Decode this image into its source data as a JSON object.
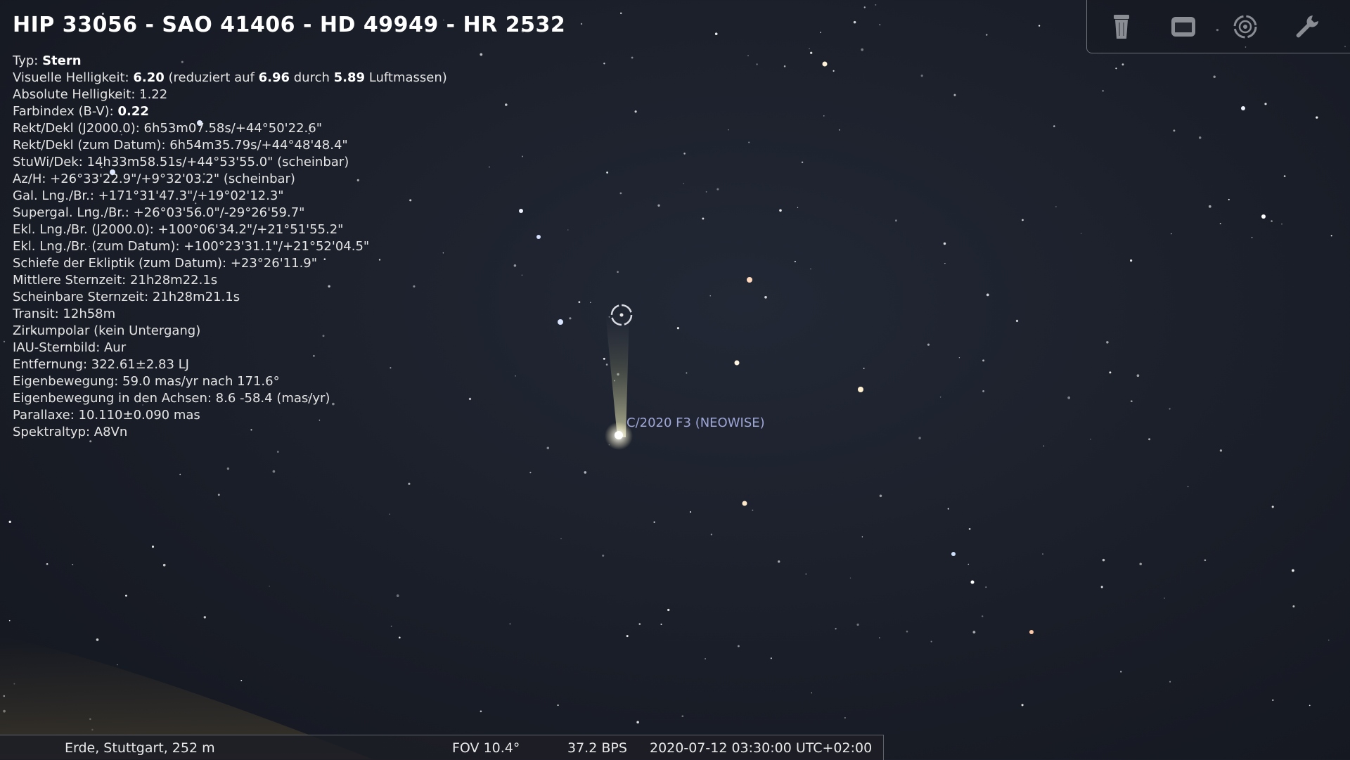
{
  "info": {
    "title": "HIP 33056 - SAO 41406 - HD 49949 - HR 2532",
    "lines": [
      {
        "label": "Typ: ",
        "value": "Stern"
      },
      {
        "label": "Visuelle Helligkeit: ",
        "value": "6.20",
        "extra": " (reduziert auf ",
        "value2": "6.96",
        "extra2": " durch ",
        "value3": "5.89",
        "extra3": " Luftmassen)"
      },
      {
        "label": "Absolute Helligkeit: 1.22"
      },
      {
        "label": "Farbindex (B-V): ",
        "value": "0.22"
      },
      {
        "label": "Rekt/Dekl (J2000.0): 6h53m07.58s/+44°50'22.6\""
      },
      {
        "label": "Rekt/Dekl (zum Datum): 6h54m35.79s/+44°48'48.4\""
      },
      {
        "label": "StuWi/Dek: 14h33m58.51s/+44°53'55.0\" (scheinbar)"
      },
      {
        "label": "Az/H: +26°33'22.9\"/+9°32'03.2\" (scheinbar)"
      },
      {
        "label": "Gal. Lng./Br.: +171°31'47.3\"/+19°02'12.3\""
      },
      {
        "label": "Supergal. Lng./Br.: +26°03'56.0\"/-29°26'59.7\""
      },
      {
        "label": "Ekl. Lng./Br. (J2000.0): +100°06'34.2\"/+21°51'55.2\""
      },
      {
        "label": "Ekl. Lng./Br. (zum Datum): +100°23'31.1\"/+21°52'04.5\""
      },
      {
        "label": "Schiefe der Ekliptik (zum Datum): +23°26'11.9\""
      },
      {
        "label": "Mittlere Sternzeit: 21h28m22.1s"
      },
      {
        "label": "Scheinbare Sternzeit: 21h28m21.1s"
      },
      {
        "label": "Transit: 12h58m"
      },
      {
        "label": "Zirkumpolar (kein Untergang)"
      },
      {
        "label": "IAU-Sternbild: Aur"
      },
      {
        "label": "Entfernung: 322.61±2.83 LJ"
      },
      {
        "label": "Eigenbewegung: 59.0 mas/yr nach 171.6°"
      },
      {
        "label": "Eigenbewegung in den Achsen: 8.6 -58.4 (mas/yr)"
      },
      {
        "label": "Parallaxe: 10.110±0.090 mas"
      },
      {
        "label": "Spektraltyp: A8Vn"
      }
    ]
  },
  "comet": {
    "label": "C/2020 F3 (NEOWISE)"
  },
  "toolbar": {
    "icons": [
      "trash-icon",
      "window-icon",
      "target-icon",
      "wrench-icon"
    ]
  },
  "status": {
    "location": "Erde, Stuttgart, 252 m",
    "fov": "FOV 10.4°",
    "fps": "37.2 BPS",
    "datetime": "2020-07-12 03:30:00 UTC+02:00"
  },
  "colors": {
    "sky": "#1a1e28",
    "comet_label": "#9ea6d6",
    "toolbar_border": "#6b6f78"
  }
}
